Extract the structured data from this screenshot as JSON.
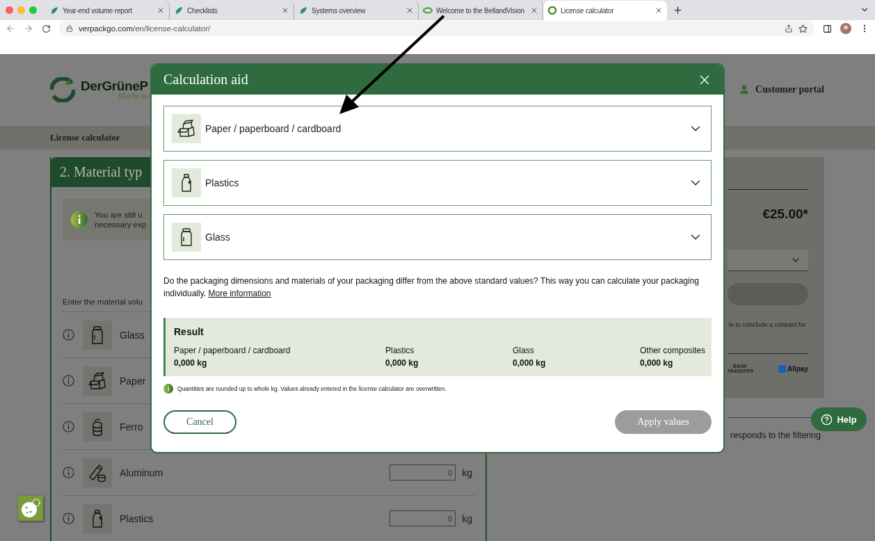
{
  "browser": {
    "tabs": [
      {
        "title": "Year-end volume report",
        "selected": false
      },
      {
        "title": "Checklists",
        "selected": false
      },
      {
        "title": "Systems overview",
        "selected": false
      },
      {
        "title": "Welcome to the BellandVision",
        "selected": false
      },
      {
        "title": "License calculator",
        "selected": true
      }
    ],
    "address": {
      "host": "verpackgo.com",
      "path": "/en/license-calculator/"
    }
  },
  "page": {
    "logo": {
      "name": "DerGrüneP",
      "tagline": "Macht wa"
    },
    "customer_portal": "Customer portal",
    "subnav": "License calculator",
    "material_card": {
      "title": "2. Material typ",
      "info_lines": [
        "You are still u",
        "necessary exp"
      ],
      "prompt": "Enter the material volu",
      "rows": [
        {
          "kind": "glass",
          "label": "Glass"
        },
        {
          "kind": "paper",
          "label": "Paper"
        },
        {
          "kind": "ferrous",
          "label": "Ferro"
        },
        {
          "kind": "aluminum",
          "label": "Aluminum",
          "placeholder": "0",
          "unit": "kg"
        },
        {
          "kind": "plastics",
          "label": "Plastics",
          "placeholder": "0",
          "unit": "kg"
        }
      ]
    },
    "summary": {
      "price": "€25.00*",
      "note": "le to conclude a contract for",
      "payments": [
        {
          "kind": "bank",
          "label": "BANK TRANSFER"
        },
        {
          "kind": "alipay",
          "label": "Alipay"
        }
      ],
      "footer_text": "responds to the filtering"
    },
    "help_button": "Help"
  },
  "modal": {
    "title": "Calculation aid",
    "accordions": [
      {
        "kind": "paper",
        "label": "Paper / paperboard / cardboard",
        "expanded": false
      },
      {
        "kind": "plastics",
        "label": "Plastics",
        "expanded": false
      },
      {
        "kind": "glass",
        "label": "Glass",
        "expanded": false
      }
    ],
    "description": "Do the packaging dimensions and materials of your packaging differ from the above standard values? This way you can calculate your packaging individually.",
    "link": "More information",
    "result": {
      "title": "Result",
      "items": [
        {
          "label": "Paper / paperboard / cardboard",
          "value": "0,000 kg"
        },
        {
          "label": "Plastics",
          "value": "0,000 kg"
        },
        {
          "label": "Glass",
          "value": "0,000 kg"
        },
        {
          "label": "Other composites",
          "value": "0,000 kg"
        }
      ]
    },
    "note": "Quantities are rounded up to whole kg. Values already entered in the license calculator are overwritten.",
    "cancel": "Cancel",
    "apply": {
      "label": "Apply values",
      "disabled": true
    }
  }
}
